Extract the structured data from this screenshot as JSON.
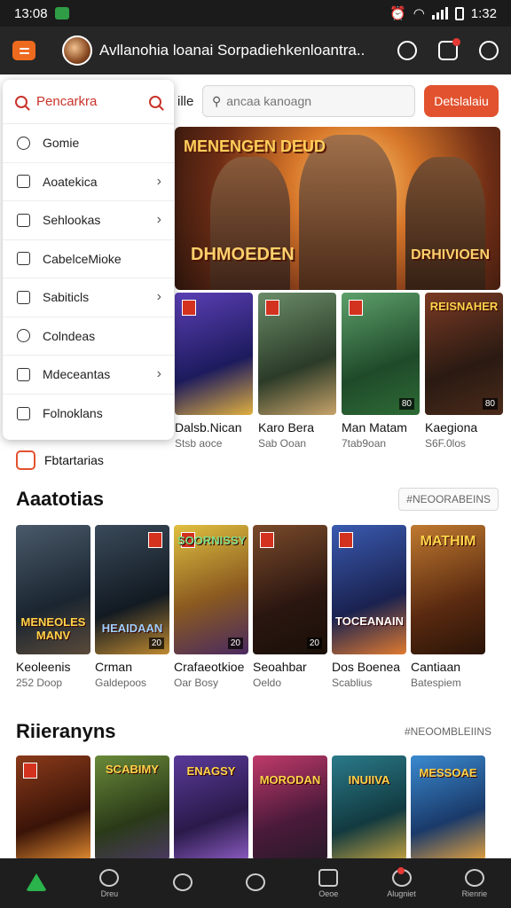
{
  "status_bar": {
    "time_left": "13:08",
    "time_right": "1:32"
  },
  "app_bar": {
    "title": "Avllanohia loanai Sorpadiehkenloantra...",
    "icons": [
      "menu-icon",
      "game-controller-icon",
      "notification-icon",
      "settings-icon"
    ]
  },
  "search_row": {
    "label": "ille",
    "placeholder": "ancaa kanoagn",
    "button_label": "Detslalaiu"
  },
  "drawer": {
    "search_label": "Pencarkra",
    "items": [
      {
        "label": "Gomie",
        "icon": "game-icon",
        "has_arrow": false
      },
      {
        "label": "Aoatekica",
        "icon": "category-icon",
        "has_arrow": true
      },
      {
        "label": "Sehlookas",
        "icon": "home-icon",
        "has_arrow": true
      },
      {
        "label": "CabelceMioke",
        "icon": "list-icon",
        "has_arrow": false
      },
      {
        "label": "Sabiticls",
        "icon": "box-icon",
        "has_arrow": true
      },
      {
        "label": "Colndeas",
        "icon": "gear-icon",
        "has_arrow": false
      },
      {
        "label": "Mdeceantas",
        "icon": "library-icon",
        "has_arrow": true
      },
      {
        "label": "Folnoklans",
        "icon": "checkbox-icon",
        "has_arrow": false
      }
    ]
  },
  "hero": {
    "text_top": "MENENGEN DEUD",
    "text_bottom": "DHMOEDEN",
    "text_right": "DRHIVIOEN"
  },
  "featured_row": [
    {
      "title": "Dalsb.Nican",
      "sub": "Stsb aoce",
      "num": ""
    },
    {
      "title": "Karo Bera",
      "sub": "Sab Ooan",
      "num": ""
    },
    {
      "title": "Man Matam",
      "sub": "7tab9oan",
      "num": "80"
    },
    {
      "title": "Kaegiona",
      "sub": "S6F.0los",
      "num": "80",
      "banner": "REISNAHER"
    }
  ],
  "favorites_label": "Fbtartarias",
  "section1": {
    "title": "Aaatotias",
    "see_all": "#NEOORABEINS",
    "cards": [
      {
        "title": "Keoleenis",
        "sub": "252 Doop",
        "banner": "MENEOLES MANV",
        "num": ""
      },
      {
        "title": "Crman",
        "sub": "Galdepoos",
        "banner": "HEAIDAAN",
        "num": "20"
      },
      {
        "title": "Crafaeotkioe",
        "sub": "Oar Bosy",
        "banner": "SOORNISSY",
        "num": "20"
      },
      {
        "title": "Seoahbar",
        "sub": "Oeldo",
        "banner": "",
        "num": "20"
      },
      {
        "title": "Dos Boenea",
        "sub": "Scablius",
        "banner": "TOCEANAIN",
        "num": ""
      },
      {
        "title": "Cantiaan",
        "sub": "Batespiem",
        "banner": "MATHIM",
        "num": ""
      }
    ]
  },
  "section2": {
    "title": "Riieranyns",
    "see_all": "#NEOOMBLEIINS",
    "cards": [
      {
        "banner": ""
      },
      {
        "banner": "SCABIMY"
      },
      {
        "banner": "ENAGSY"
      },
      {
        "banner": "MORODAN"
      },
      {
        "banner": "INUIIVA"
      },
      {
        "banner": "MESSOAE"
      }
    ]
  },
  "bottom_nav": [
    {
      "label": "",
      "icon": "home-icon",
      "active": true
    },
    {
      "label": "Dreu",
      "icon": "gear-icon"
    },
    {
      "label": "",
      "icon": "search-icon"
    },
    {
      "label": "",
      "icon": "shield-icon"
    },
    {
      "label": "Oeoe",
      "icon": "tv-icon"
    },
    {
      "label": "Alugniet",
      "icon": "notification-icon",
      "dot": true
    },
    {
      "label": "Rienrie",
      "icon": "profile-icon"
    }
  ],
  "colors": {
    "accent": "#e2522e",
    "appbar": "#262626",
    "nav_active": "#2bb34c"
  }
}
